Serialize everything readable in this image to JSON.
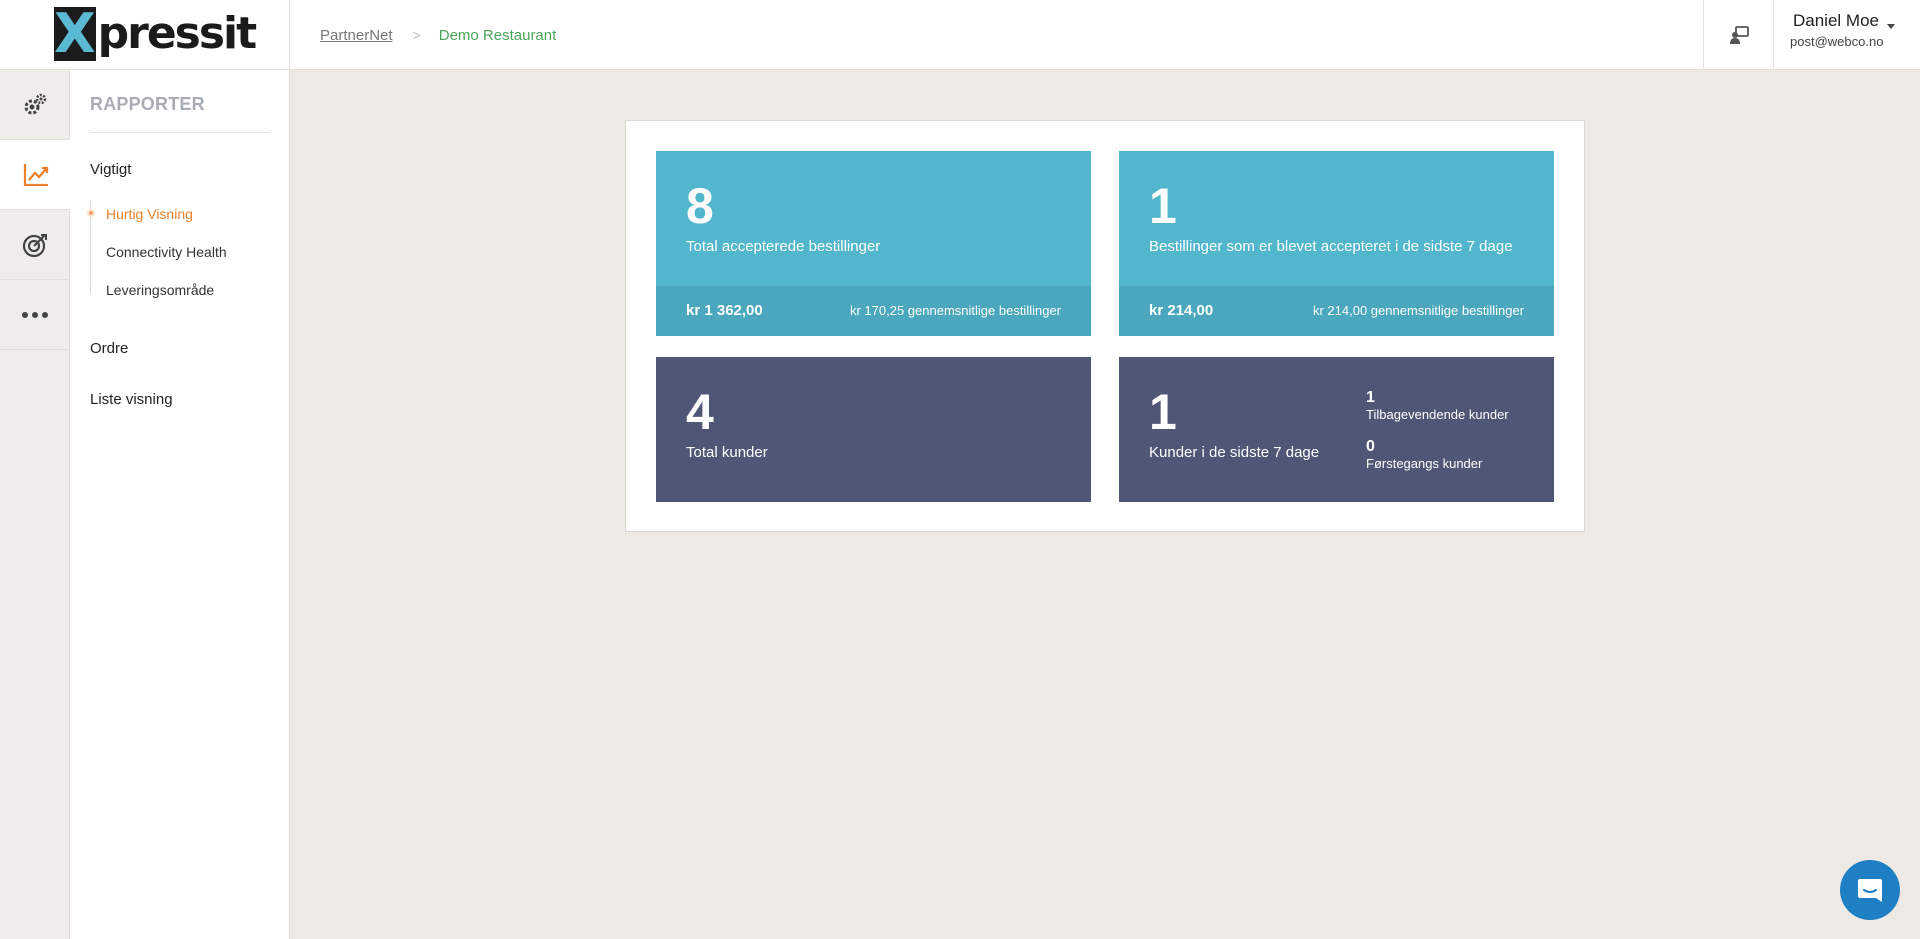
{
  "header": {
    "logo": {
      "mark": "X",
      "text": "pressit"
    },
    "breadcrumb": {
      "root": "PartnerNet",
      "separator": ">",
      "current": "Demo Restaurant"
    },
    "user": {
      "name": "Daniel Moe",
      "email": "post@webco.no"
    }
  },
  "rail": {
    "items": [
      {
        "icon": "gears-icon"
      },
      {
        "icon": "chart-line-icon",
        "active": true
      },
      {
        "icon": "target-icon"
      },
      {
        "icon": "more-dots-icon"
      }
    ]
  },
  "subnav": {
    "title": "RAPPORTER",
    "section_important": "Vigtigt",
    "items": [
      "Hurtig Visning",
      "Connectivity Health",
      "Leveringsområde"
    ],
    "active_item": "Hurtig Visning",
    "section_orders": "Ordre",
    "section_list": "Liste visning"
  },
  "stats": {
    "total_orders": {
      "value": "8",
      "label": "Total accepterede bestillinger",
      "amount": "kr 1 362,00",
      "average": "kr 170,25 gennemsnitlige bestillinger"
    },
    "recent_orders": {
      "value": "1",
      "label": "Bestillinger som er blevet accepteret i de sidste 7 dage",
      "amount": "kr 214,00",
      "average": "kr 214,00 gennemsnitlige bestillinger"
    },
    "total_customers": {
      "value": "4",
      "label": "Total kunder"
    },
    "recent_customers": {
      "value": "1",
      "label": "Kunder i de sidste 7 dage",
      "returning_value": "1",
      "returning_label": "Tilbagevendende kunder",
      "first_value": "0",
      "first_label": "Førstegangs kunder"
    }
  },
  "colors": {
    "accent": "#e8802c",
    "cyan_card": "#52b6cd",
    "navy_card": "#4f5676",
    "breadcrumb_current": "#4aa55a"
  },
  "chat": {
    "icon": "chat-bubble-icon"
  }
}
